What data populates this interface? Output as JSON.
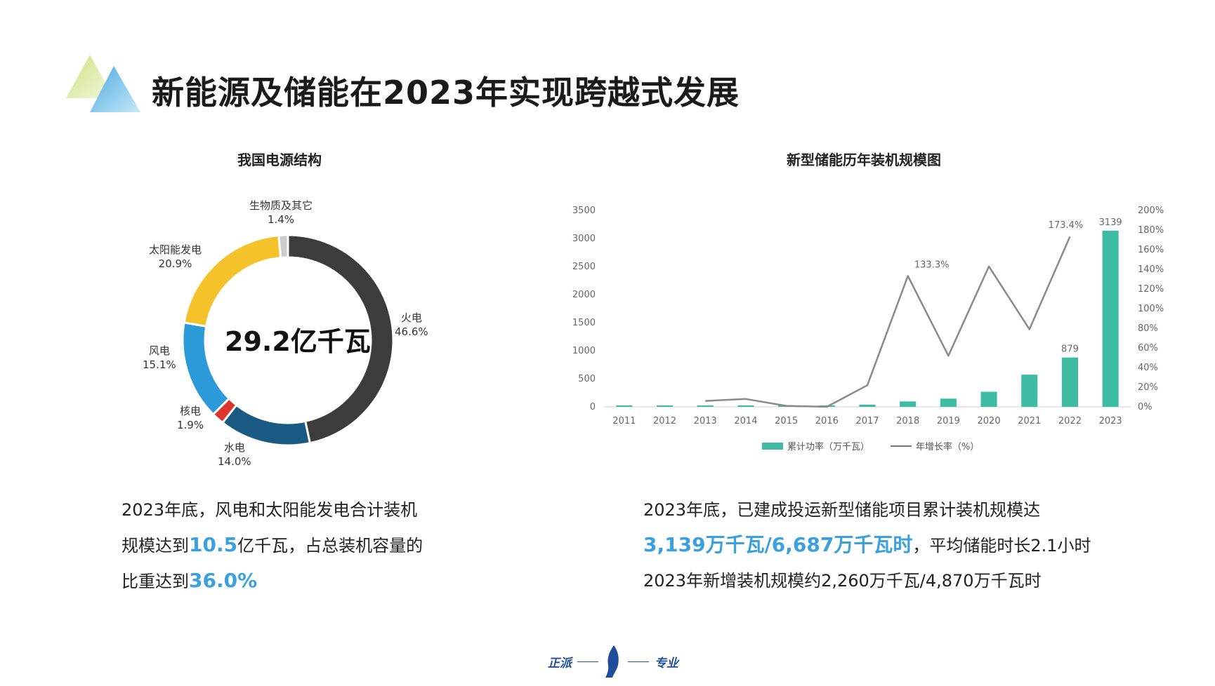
{
  "title": "新能源及储能在2023年实现跨越式发展",
  "colors": {
    "accent": "#3aa0de",
    "fire": "#3c3c3c",
    "hydro": "#1b5a82",
    "nuclear": "#e0342f",
    "wind": "#2b9ad8",
    "solar": "#f4c22b",
    "bio": "#cccccc",
    "bar": "#3dbba3",
    "line": "#8a8a8a"
  },
  "donut": {
    "title": "我国电源结构",
    "center": "29.2亿千瓦",
    "segments": [
      {
        "name": "火电",
        "pct_text": "46.6%",
        "value": 46.6,
        "color_key": "fire"
      },
      {
        "name": "水电",
        "pct_text": "14.0%",
        "value": 14.0,
        "color_key": "hydro"
      },
      {
        "name": "核电",
        "pct_text": "1.9%",
        "value": 1.9,
        "color_key": "nuclear"
      },
      {
        "name": "风电",
        "pct_text": "15.1%",
        "value": 15.1,
        "color_key": "wind"
      },
      {
        "name": "太阳能发电",
        "pct_text": "20.9%",
        "value": 20.9,
        "color_key": "solar"
      },
      {
        "name": "生物质及其它",
        "pct_text": "1.4%",
        "value": 1.4,
        "color_key": "bio"
      }
    ]
  },
  "chart_data": {
    "type": "bar",
    "title": "新型储能历年装机规模图",
    "categories": [
      "2011",
      "2012",
      "2013",
      "2014",
      "2015",
      "2016",
      "2017",
      "2018",
      "2019",
      "2020",
      "2021",
      "2022",
      "2023"
    ],
    "ylim": [
      0,
      3500
    ],
    "y_ticks": [
      "0",
      "500",
      "1000",
      "1500",
      "2000",
      "2500",
      "3000",
      "3500"
    ],
    "y2lim": [
      0,
      200
    ],
    "y2_ticks": [
      "0%",
      "20%",
      "40%",
      "60%",
      "80%",
      "100%",
      "120%",
      "140%",
      "160%",
      "180%",
      "200%"
    ],
    "series": [
      {
        "name": "累计功率（万千瓦）",
        "kind": "bar",
        "values": [
          5,
          8,
          10,
          16,
          17,
          17,
          39,
          96,
          146,
          269,
          573,
          879,
          3139
        ]
      },
      {
        "name": "年增长率（%）",
        "kind": "line",
        "axis": "right",
        "start_index": 2,
        "values": [
          null,
          null,
          6,
          8,
          1,
          0,
          22,
          133.3,
          52,
          143,
          79,
          173.4,
          null
        ]
      }
    ],
    "bar_labels": [
      {
        "index": 11,
        "text": "879"
      },
      {
        "index": 12,
        "text": "3139"
      }
    ],
    "line_labels": [
      {
        "index": 7,
        "text": "133.3%"
      },
      {
        "index": 11,
        "text": "173.4%"
      }
    ]
  },
  "left_text": {
    "line1": "2023年底，风电和太阳能发电合计装机",
    "line2_prefix": "规模达到",
    "line2_highlight": "10.5",
    "line2_suffix": "亿千瓦，占总装机容量的",
    "line3_prefix": "比重达到",
    "line3_highlight": "36.0%"
  },
  "right_text": {
    "line1": "2023年底，已建成投运新型储能项目累计装机规模达",
    "line2_highlight": "3,139万千瓦/6,687万千瓦时",
    "line2_suffix": "，平均储能时长2.1小时",
    "line3": "2023年新增装机规模约2,260万千瓦/4,870万千瓦时"
  },
  "footer": {
    "left": "正派",
    "right": "专业"
  }
}
